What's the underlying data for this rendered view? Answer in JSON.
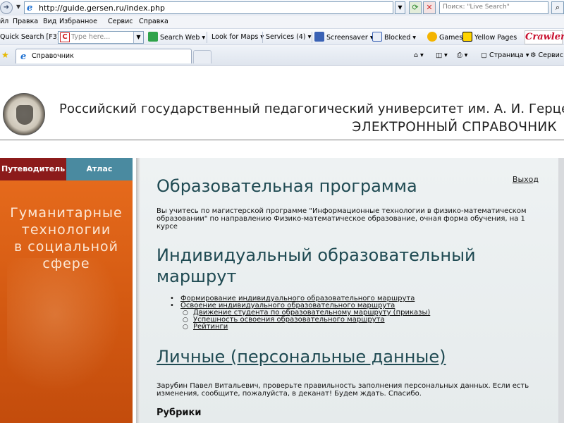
{
  "browser": {
    "url": "http://guide.gersen.ru/index.php",
    "search_placeholder": "Поиск: \"Live Search\"",
    "menu": [
      "йл",
      "Правка",
      "Вид",
      "Избранное",
      "Сервис",
      "Справка"
    ],
    "toolbar": {
      "quick_search_label": "Quick Search [F3]",
      "quick_search_placeholder": "Type here...",
      "search_web": "Search Web",
      "look_for_maps": "Look for Maps",
      "services": "Services (4)",
      "screensaver": "Screensaver",
      "blocked": "Blocked",
      "games": "Games",
      "yellow_pages": "Yellow Pages",
      "crawler": "Crawler"
    },
    "tab_title": "Справочник",
    "commands": {
      "page": "Страница",
      "service": "Сервис"
    }
  },
  "header": {
    "university": "Российский государственный педагогический университет им. А. И. Герцена",
    "handbook": "ЭЛЕКТРОННЫЙ СПРАВОЧНИК"
  },
  "sidebar": {
    "tabs": [
      "Путеводитель",
      "Атлас"
    ],
    "promo_lines": [
      "Гуманитарные",
      "технологии",
      "в социальной",
      "сфере"
    ]
  },
  "main": {
    "logout": "Выход",
    "program_heading": "Образовательная программа",
    "program_text": "Вы учитесь по магистерской программе \"Информационные технологии в физико-математическом образовании\" по направлению Физико-математическое образование, очная форма обучения, на 1 курсе",
    "route_heading": "Индивидуальный образовательный маршрут",
    "route_links": [
      "Формирование индивидуального образовательного маршрута",
      "Освоение индивидуального образовательного маршрута"
    ],
    "route_sublinks": [
      "Движение студента по образовательному маршруту (приказы)",
      "Успешность освоения образовательного маршрута",
      "Рейтинги"
    ],
    "personal_heading": "Личные (персональные данные)",
    "personal_text": "Зарубин Павел Витальевич, проверьте правильность заполнения персональных данных. Если есть изменения, сообщите, пожалуйста, в деканат! Будем ждать. Спасибо.",
    "rubrics_heading": "Рубрики"
  }
}
